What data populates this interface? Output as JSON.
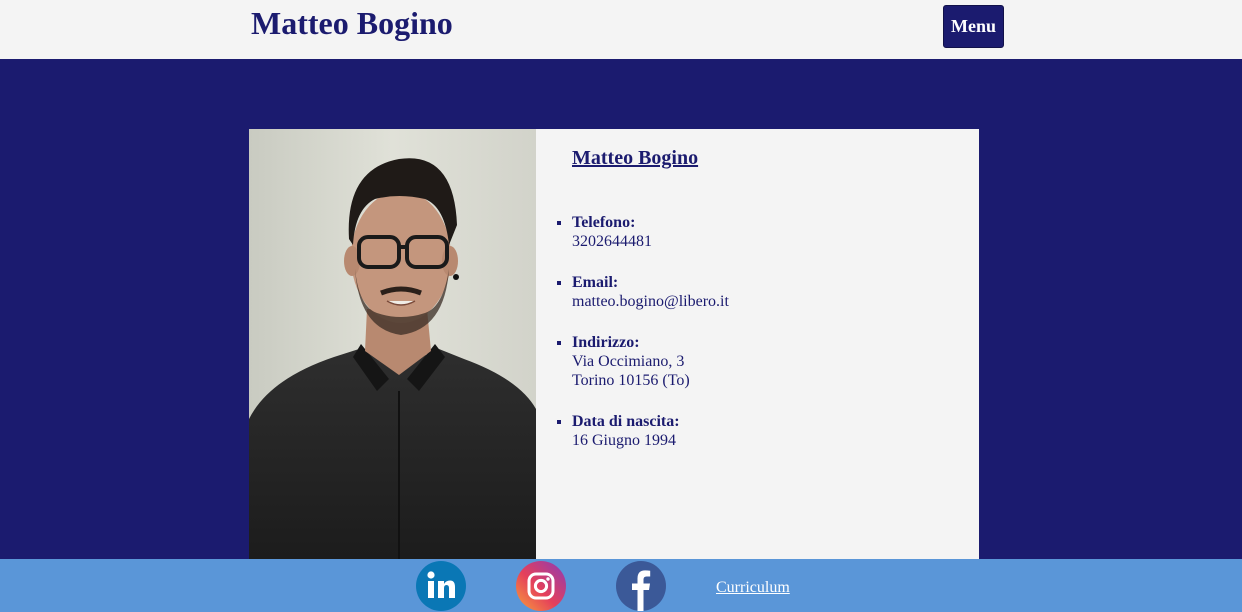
{
  "header": {
    "site_title": "Matteo Bogino",
    "menu_label": "Menu"
  },
  "profile": {
    "name": "Matteo Bogino",
    "photo_alt": "profile-photo",
    "details": [
      {
        "label": "Telefono:",
        "lines": [
          "3202644481"
        ]
      },
      {
        "label": "Email:",
        "lines": [
          "matteo.bogino@libero.it"
        ]
      },
      {
        "label": "Indirizzo:",
        "lines": [
          "Via Occimiano, 3",
          "Torino 10156 (To)"
        ]
      },
      {
        "label": "Data di nascita:",
        "lines": [
          "16 Giugno 1994"
        ]
      }
    ]
  },
  "footer": {
    "social": [
      {
        "name": "linkedin",
        "icon": "linkedin-icon",
        "color": "#0a77b5"
      },
      {
        "name": "instagram",
        "icon": "instagram-icon",
        "color": "#d6366e"
      },
      {
        "name": "facebook",
        "icon": "facebook-icon",
        "color": "#3b5998"
      }
    ],
    "cv_link_label": "Curriculum"
  },
  "colors": {
    "primary": "#1b1b6f",
    "header_bg": "#f4f4f4",
    "footer_bg": "#5a96d8"
  }
}
